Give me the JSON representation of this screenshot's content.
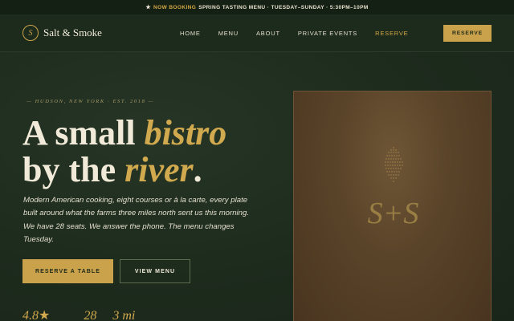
{
  "announcement": {
    "star": "★",
    "highlight": "NOW BOOKING",
    "text": "SPRING TASTING MENU · TUESDAY–SUNDAY · 5:30PM–10PM"
  },
  "nav": {
    "brand_mark": "S",
    "brand_name": "Salt & Smoke",
    "links": [
      {
        "label": "HOME"
      },
      {
        "label": "MENU"
      },
      {
        "label": "ABOUT"
      },
      {
        "label": "PRIVATE EVENTS"
      },
      {
        "label": "RESERVE"
      }
    ],
    "active_link": "RESERVE",
    "cta_label": "RESERVE"
  },
  "hero": {
    "eyebrow": "— HUDSON, NEW YORK · EST. 2018 —",
    "headline": {
      "part1": "A small ",
      "italic1": "bistro",
      "part2": "by the ",
      "italic2": "river",
      "end": "."
    },
    "lede": "Modern American cooking, eight courses or à la carte, every plate built around what the farms three miles north sent us this morning. We have 28 seats. We answer the phone. The menu changes Tuesday.",
    "primary_button": "RESERVE A TABLE",
    "secondary_button": "VIEW MENU",
    "stats": [
      {
        "value": "4.8",
        "suffix": "★"
      },
      {
        "value": "28"
      },
      {
        "value": "3 mi"
      }
    ]
  },
  "menu_card": {
    "monogram": "S+S"
  },
  "colors": {
    "background": "#1c2a1c",
    "accent_gold": "#c9a24b",
    "card_brown": "#5a4429",
    "text_cream": "#efe8d8"
  }
}
